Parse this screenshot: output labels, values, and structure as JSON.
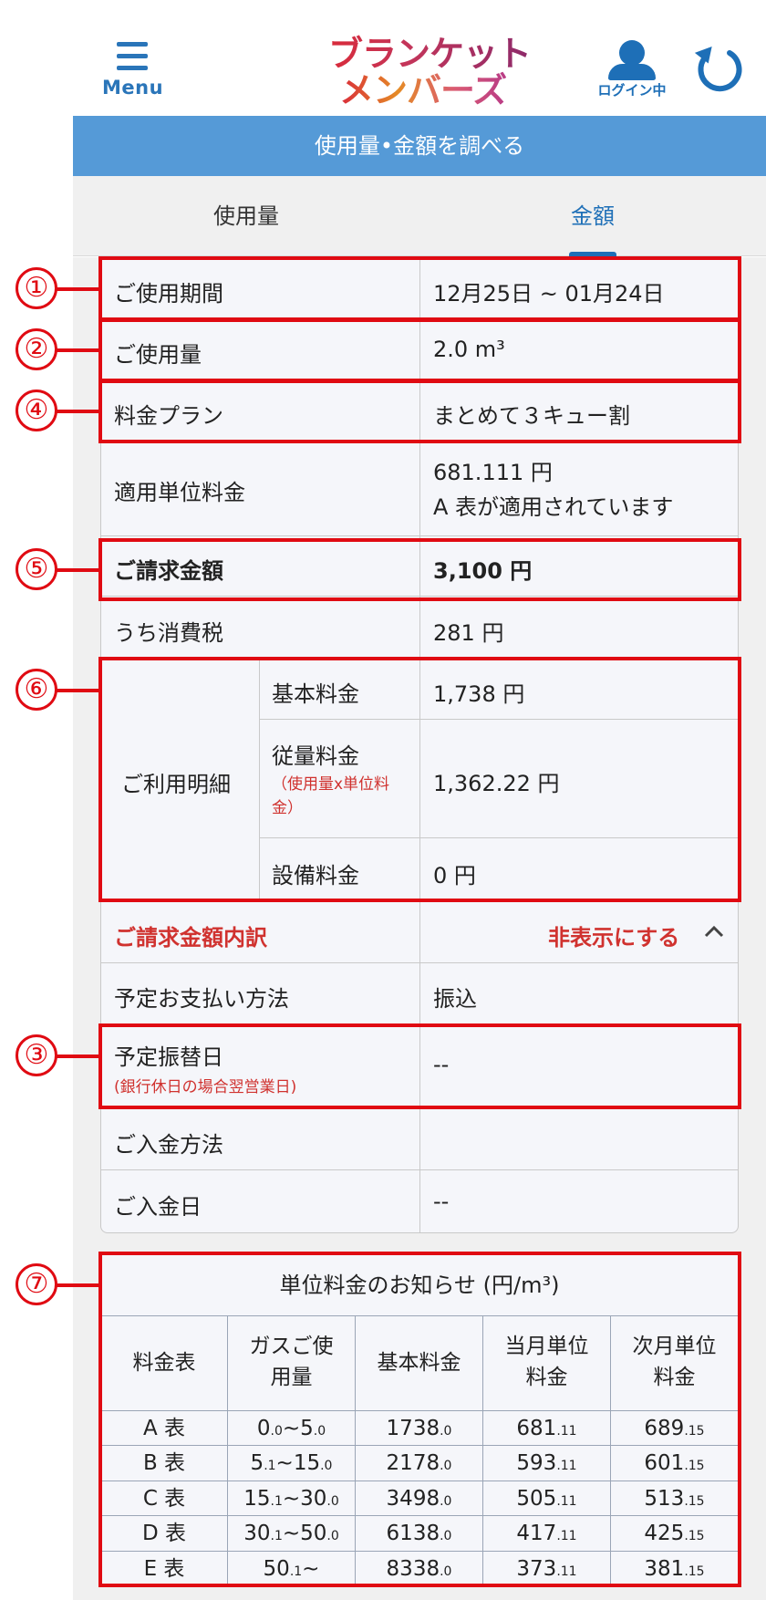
{
  "header": {
    "menu_label": "Menu",
    "logo_line1": "ブランケット",
    "logo_line2": "メンバーズ",
    "login_label": "ログイン中"
  },
  "title": "使用量•金額を調べる",
  "tabs": [
    {
      "label": "使用量",
      "active": false
    },
    {
      "label": "金額",
      "active": true
    }
  ],
  "detail": {
    "period": {
      "label": "ご使用期間",
      "value": "12月25日 ~ 01月24日"
    },
    "usage": {
      "label": "ご使用量",
      "value": "2.0 m³"
    },
    "plan": {
      "label": "料金プラン",
      "value": "まとめて３キュー割"
    },
    "unit_price": {
      "label": "適用単位料金",
      "value_line1": "681.111 円",
      "value_line2": "A 表が適用されています"
    },
    "billing": {
      "label": "ご請求金額",
      "value": "3,100 円"
    },
    "tax": {
      "label": "うち消費税",
      "value": "281 円"
    },
    "breakdown": {
      "label": "ご利用明細",
      "base": {
        "label": "基本料金",
        "value": "1,738 円"
      },
      "volume": {
        "label": "従量料金",
        "note": "（使用量x単位料金）",
        "value": "1,362.22 円"
      },
      "equipment": {
        "label": "設備料金",
        "value": "0 円"
      }
    },
    "billing_breakdown": {
      "label": "ご請求金額内訳",
      "toggle": "非表示にする"
    },
    "payment_method": {
      "label": "予定お支払い方法",
      "value": "振込"
    },
    "transfer_date": {
      "label": "予定振替日",
      "note": "(銀行休日の場合翌営業日)",
      "value": "--"
    },
    "deposit_method": {
      "label": "ご入金方法",
      "value": ""
    },
    "deposit_date": {
      "label": "ご入金日",
      "value": "--"
    }
  },
  "rate_table": {
    "title": "単位料金のお知らせ (円/m³)",
    "headers": [
      "料金表",
      "ガスご使用量",
      "基本料金",
      "当月単位料金",
      "次月単位料金"
    ],
    "header_lines": [
      [
        "料金表"
      ],
      [
        "ガスご使",
        "用量"
      ],
      [
        "基本料金"
      ],
      [
        "当月単位",
        "料金"
      ],
      [
        "次月単位",
        "料金"
      ]
    ],
    "rows": [
      [
        [
          "A 表",
          ""
        ],
        [
          "0",
          ".0",
          "~5",
          ".0"
        ],
        [
          "1738",
          ".0"
        ],
        [
          "681",
          ".11"
        ],
        [
          "689",
          ".15"
        ]
      ],
      [
        [
          "B 表",
          ""
        ],
        [
          "5",
          ".1",
          "~15",
          ".0"
        ],
        [
          "2178",
          ".0"
        ],
        [
          "593",
          ".11"
        ],
        [
          "601",
          ".15"
        ]
      ],
      [
        [
          "C 表",
          ""
        ],
        [
          "15",
          ".1",
          "~30",
          ".0"
        ],
        [
          "3498",
          ".0"
        ],
        [
          "505",
          ".11"
        ],
        [
          "513",
          ".15"
        ]
      ],
      [
        [
          "D 表",
          ""
        ],
        [
          "30",
          ".1",
          "~50",
          ".0"
        ],
        [
          "6138",
          ".0"
        ],
        [
          "417",
          ".11"
        ],
        [
          "425",
          ".15"
        ]
      ],
      [
        [
          "E 表",
          ""
        ],
        [
          "50",
          ".1",
          "~",
          ""
        ],
        [
          "8338",
          ".0"
        ],
        [
          "373",
          ".11"
        ],
        [
          "381",
          ".15"
        ]
      ]
    ]
  },
  "annotations": [
    "①",
    "②",
    "④",
    "⑤",
    "⑥",
    "③",
    "⑦"
  ],
  "colors": {
    "accent_blue": "#1e6fb7",
    "title_bar": "#559ad7",
    "annotation_red": "#e00a12",
    "label_red": "#d0322f"
  }
}
